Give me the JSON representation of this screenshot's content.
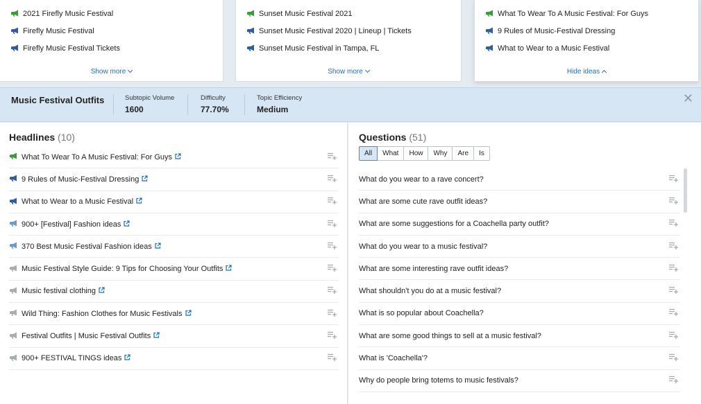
{
  "cards": [
    {
      "items": [
        {
          "icon": "megaphone-green-icon",
          "text": "2021 Firefly Music Festival"
        },
        {
          "icon": "megaphone-blue-icon",
          "text": "Firefly Music Festival"
        },
        {
          "icon": "megaphone-blue-icon",
          "text": "Firefly Music Festival Tickets"
        }
      ],
      "link_label": "Show more"
    },
    {
      "items": [
        {
          "icon": "megaphone-green-icon",
          "text": "Sunset Music Festival 2021"
        },
        {
          "icon": "megaphone-blue-icon",
          "text": "Sunset Music Festival 2020 | Lineup | Tickets"
        },
        {
          "icon": "megaphone-blue-icon",
          "text": "Sunset Music Festival in Tampa, FL"
        }
      ],
      "link_label": "Show more"
    },
    {
      "items": [
        {
          "icon": "megaphone-green-icon",
          "text": "What To Wear To A Music Festival: For Guys"
        },
        {
          "icon": "megaphone-blue-icon",
          "text": "9 Rules of Music-Festival Dressing"
        },
        {
          "icon": "megaphone-blue-icon",
          "text": "What to Wear to a Music Festival"
        }
      ],
      "link_label": "Hide ideas"
    }
  ],
  "summary": {
    "title": "Music Festival Outfits",
    "metrics": [
      {
        "label": "Subtopic Volume",
        "value": "1600"
      },
      {
        "label": "Difficulty",
        "value": "77.70%"
      },
      {
        "label": "Topic Efficiency",
        "value": "Medium"
      }
    ]
  },
  "headlines": {
    "title": "Headlines",
    "count": "(10)",
    "items": [
      {
        "icon": "megaphone-green-icon",
        "text": "What To Wear To A Music Festival: For Guys"
      },
      {
        "icon": "megaphone-blue-icon",
        "text": "9 Rules of Music-Festival Dressing"
      },
      {
        "icon": "megaphone-blue-icon",
        "text": "What to Wear to a Music Festival"
      },
      {
        "icon": "megaphone-lightblue-icon",
        "text": "900+ [Festival] Fashion ideas"
      },
      {
        "icon": "megaphone-lightblue-icon",
        "text": "370 Best Music Festival Fashion ideas"
      },
      {
        "icon": "megaphone-gray-icon",
        "text": "Music Festival Style Guide: 9 Tips for Choosing Your Outfits"
      },
      {
        "icon": "megaphone-gray-icon",
        "text": "Music festival clothing"
      },
      {
        "icon": "megaphone-gray-icon",
        "text": "Wild Thing: Fashion Clothes for Music Festivals"
      },
      {
        "icon": "megaphone-gray-icon",
        "text": "Festival Outfits | Music Festival Outfits"
      },
      {
        "icon": "megaphone-gray-icon",
        "text": "900+ FESTIVAL TINGS ideas"
      }
    ]
  },
  "questions": {
    "title": "Questions",
    "count": "(51)",
    "filters": [
      "All",
      "What",
      "How",
      "Why",
      "Are",
      "Is"
    ],
    "active_filter": "All",
    "items": [
      "What do you wear to a rave concert?",
      "What are some cute rave outfit ideas?",
      "What are some suggestions for a Coachella party outfit?",
      "What do you wear to a music festival?",
      "What are some interesting rave outfit ideas?",
      "What shouldn't you do at a music festival?",
      "What is so popular about Coachella?",
      "What are some good things to sell at a music festival?",
      "What is 'Coachella'?",
      "Why do people bring totems to music festivals?"
    ]
  },
  "colors": {
    "megaphone-green": "#3a9b3a",
    "megaphone-blue": "#2d5f9e",
    "megaphone-lightblue": "#6d9cc9",
    "megaphone-gray": "#a8adb2",
    "link": "#1a6fc4",
    "summary-bg": "#d6e6f5"
  }
}
